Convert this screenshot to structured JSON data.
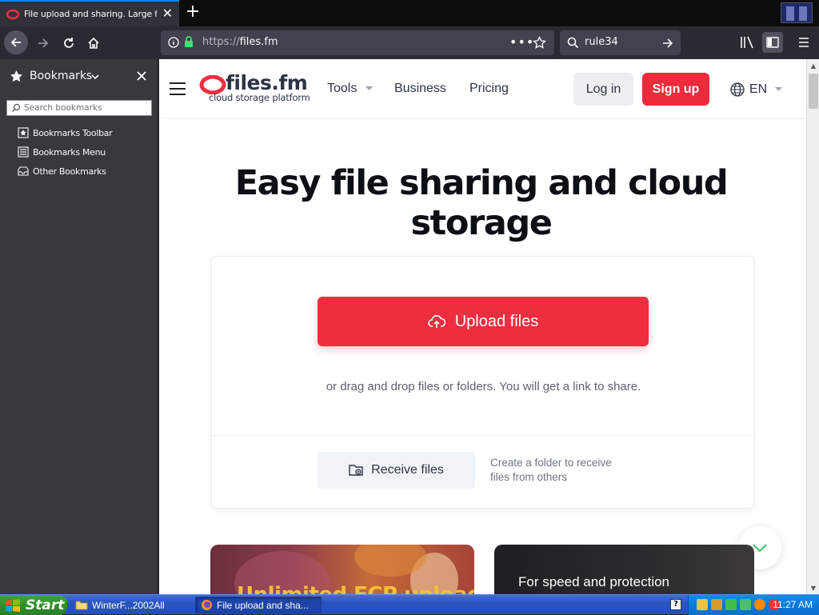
{
  "browser": {
    "tab_title": "File upload and sharing. Large file",
    "url_prefix": "https://",
    "url_domain": "files.fm",
    "search_value": "rule34"
  },
  "sidebar": {
    "title": "Bookmarks",
    "search_placeholder": "Search bookmarks",
    "items": [
      {
        "label": "Bookmarks Toolbar"
      },
      {
        "label": "Bookmarks Menu"
      },
      {
        "label": "Other Bookmarks"
      }
    ]
  },
  "site": {
    "logo_name": "files.fm",
    "logo_tagline": "cloud storage platform",
    "nav": {
      "tools": "Tools",
      "business": "Business",
      "pricing": "Pricing"
    },
    "login": "Log in",
    "signup": "Sign up",
    "lang": "EN",
    "brand_color": "#ee2e3e"
  },
  "hero": {
    "title": "Easy file sharing and cloud storage"
  },
  "upload_card": {
    "upload_label": "Upload files",
    "drag_text": "or drag and drop files or folders. You will get a link to share.",
    "receive_label": "Receive files",
    "receive_desc": "Create a folder to receive files from others"
  },
  "promos": {
    "left": "Unlimited FCP uploads",
    "right": "For speed and protection"
  },
  "taskbar": {
    "start": "Start",
    "task1": "WinterF...2002All",
    "task2": "File upload and sha...",
    "clock": "11:27 AM"
  }
}
